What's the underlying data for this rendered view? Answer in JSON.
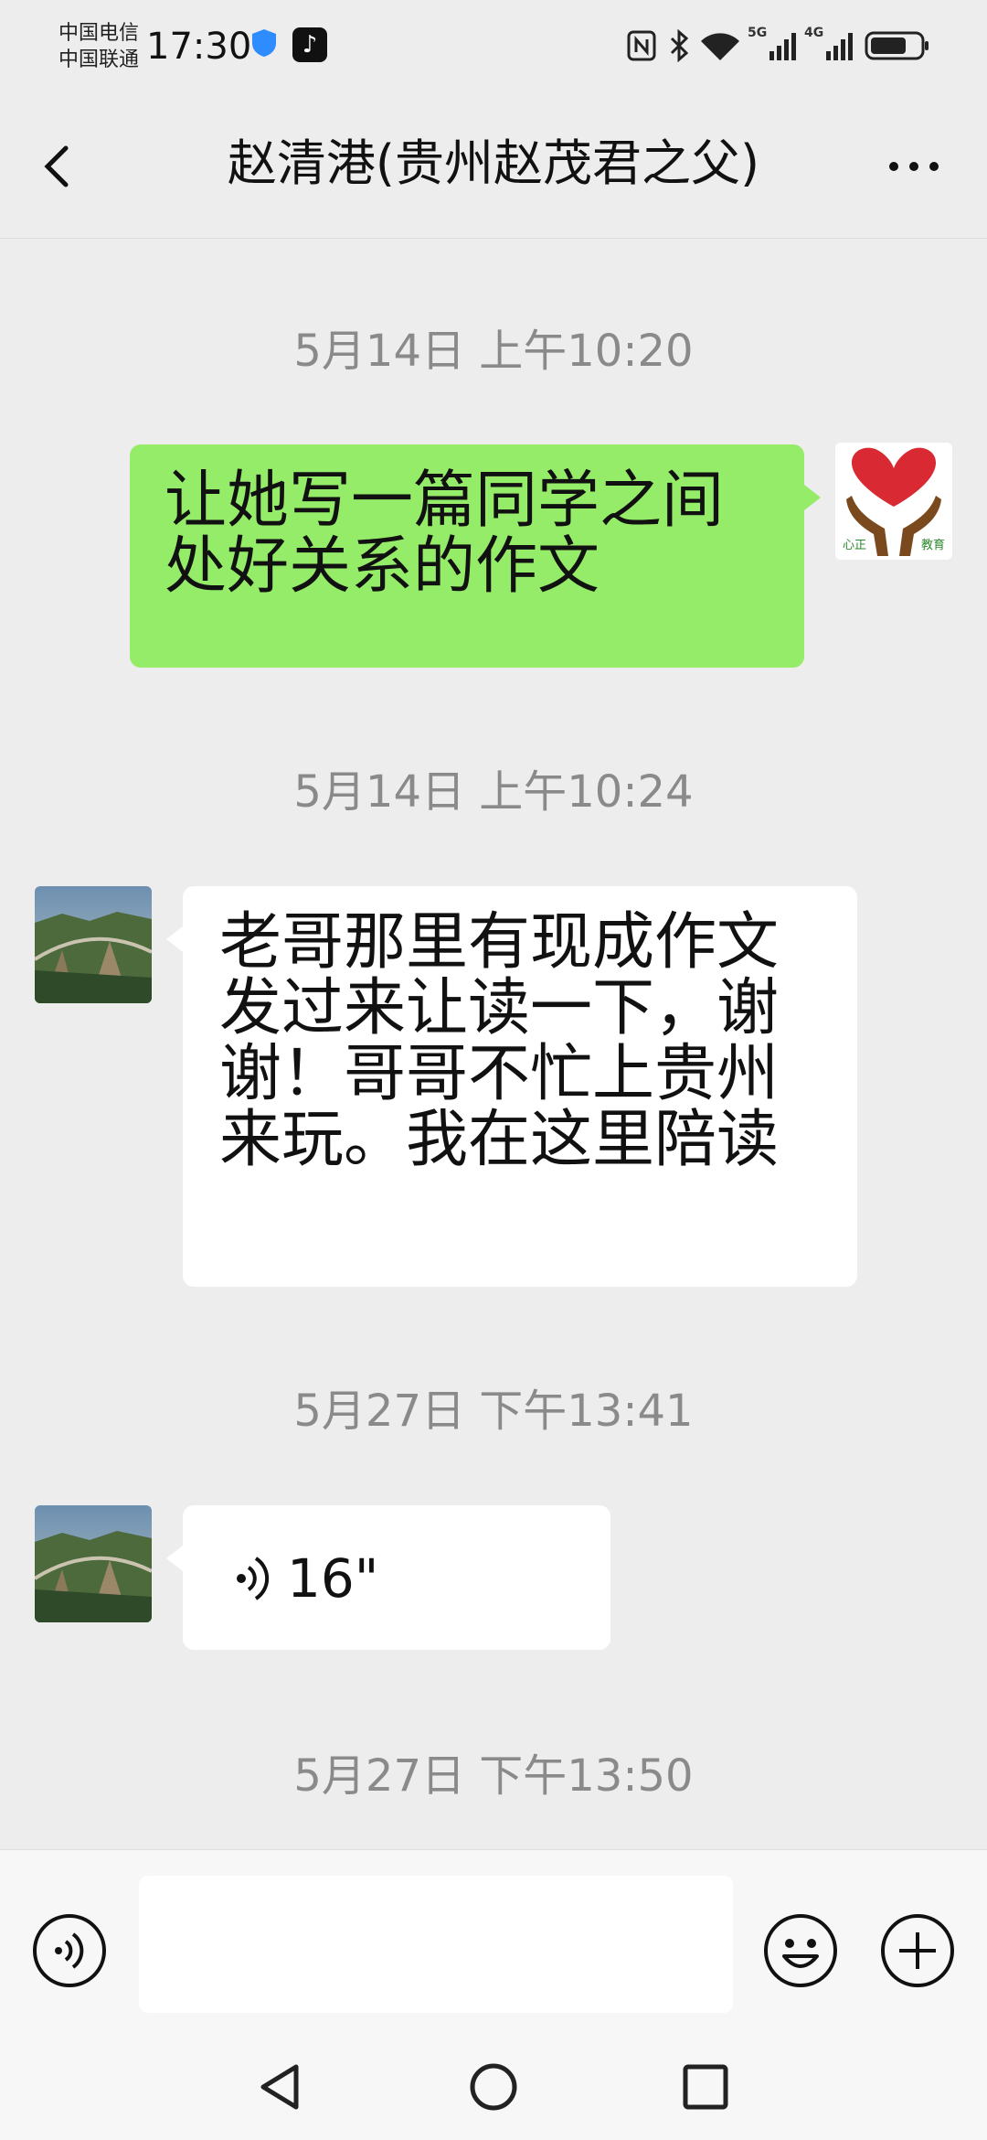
{
  "status_bar": {
    "carrier_1": "中国电信",
    "carrier_2": "中国联通",
    "time": "17:30",
    "net_5g": "5G",
    "net_4g": "4G"
  },
  "header": {
    "title": "赵清港(贵州赵茂君之父)"
  },
  "messages": [
    {
      "type": "time",
      "text": "5月14日 上午10:20"
    },
    {
      "type": "text",
      "from": "me",
      "text": "让她写一篇同学之间处好关系的作文",
      "avatar_caption_left": "心正",
      "avatar_caption_right": "教育"
    },
    {
      "type": "time",
      "text": "5月14日 上午10:24"
    },
    {
      "type": "text",
      "from": "other",
      "text": "老哥那里有现成作文发过来让读一下，谢谢！哥哥不忙上贵州来玩。我在这里陪读"
    },
    {
      "type": "time",
      "text": "5月27日 下午13:41"
    },
    {
      "type": "voice",
      "from": "other",
      "duration": "16\""
    },
    {
      "type": "time",
      "text": "5月27日 下午13:50"
    }
  ],
  "input": {
    "value": "",
    "placeholder": ""
  },
  "colors": {
    "background": "#ededed",
    "my_bubble": "#95ec69",
    "other_bubble": "#ffffff",
    "timestamp": "#8a8a8a"
  },
  "icons": [
    "shield-icon",
    "tiktok-icon",
    "nfc-icon",
    "bluetooth-icon",
    "wifi-icon",
    "signal-icon",
    "battery-icon",
    "back-icon",
    "more-icon",
    "voice-icon",
    "emoji-icon",
    "plus-icon",
    "nav-back-icon",
    "nav-home-icon",
    "nav-recents-icon"
  ]
}
